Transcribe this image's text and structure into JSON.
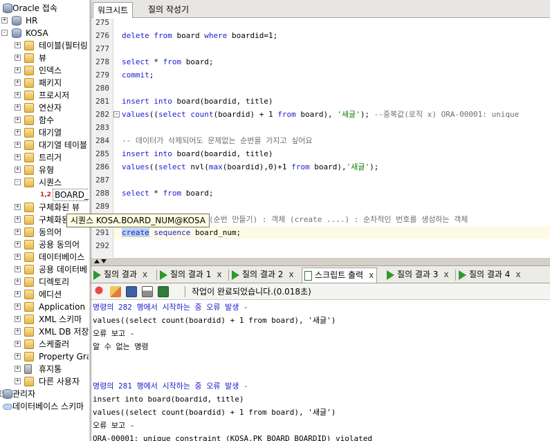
{
  "tree": {
    "items": [
      {
        "label": "Oracle 접속",
        "icon": "database-icon",
        "level": 0,
        "expander": ""
      },
      {
        "label": "HR",
        "icon": "connection-icon",
        "level": 1,
        "expander": "+"
      },
      {
        "label": "KOSA",
        "icon": "connection-icon",
        "level": 1,
        "expander": "-"
      },
      {
        "label": "테이블(필터링)",
        "icon": "table-folder-icon",
        "level": 2,
        "expander": "+"
      },
      {
        "label": "뷰",
        "icon": "view-folder-icon",
        "level": 2,
        "expander": "+"
      },
      {
        "label": "인덱스",
        "icon": "index-folder-icon",
        "level": 2,
        "expander": "+"
      },
      {
        "label": "패키지",
        "icon": "package-folder-icon",
        "level": 2,
        "expander": "+"
      },
      {
        "label": "프로시저",
        "icon": "procedure-folder-icon",
        "level": 2,
        "expander": "+"
      },
      {
        "label": "연산자",
        "icon": "operator-folder-icon",
        "level": 2,
        "expander": "+"
      },
      {
        "label": "함수",
        "icon": "function-folder-icon",
        "level": 2,
        "expander": "+"
      },
      {
        "label": "대기열",
        "icon": "queue-folder-icon",
        "level": 2,
        "expander": "+"
      },
      {
        "label": "대기열 테이블",
        "icon": "queue-table-folder-icon",
        "level": 2,
        "expander": "+"
      },
      {
        "label": "트리거",
        "icon": "trigger-folder-icon",
        "level": 2,
        "expander": "+"
      },
      {
        "label": "유형",
        "icon": "type-folder-icon",
        "level": 2,
        "expander": "+"
      },
      {
        "label": "시퀀스",
        "icon": "sequence-folder-icon",
        "level": 2,
        "expander": "-"
      },
      {
        "label": "BOARD_NUM",
        "icon": "sequence-icon",
        "level": 3,
        "expander": ""
      },
      {
        "label": "구체화된 뷰",
        "icon": "materialized-view-folder-icon",
        "level": 2,
        "expander": "+"
      },
      {
        "label": "구체화된",
        "icon": "materialized-view-log-folder-icon",
        "level": 2,
        "expander": "+"
      },
      {
        "label": "동의어",
        "icon": "synonym-folder-icon",
        "level": 2,
        "expander": "+"
      },
      {
        "label": "공용 동의어",
        "icon": "public-synonym-folder-icon",
        "level": 2,
        "expander": "+"
      },
      {
        "label": "데이터베이스",
        "icon": "db-link-folder-icon",
        "level": 2,
        "expander": "+"
      },
      {
        "label": "공용 데이터베",
        "icon": "public-db-link-folder-icon",
        "level": 2,
        "expander": "+"
      },
      {
        "label": "디렉토리",
        "icon": "directory-folder-icon",
        "level": 2,
        "expander": "+"
      },
      {
        "label": "에디션",
        "icon": "edition-folder-icon",
        "level": 2,
        "expander": "+"
      },
      {
        "label": "Application E",
        "icon": "application-express-folder-icon",
        "level": 2,
        "expander": "+"
      },
      {
        "label": "XML 스키마",
        "icon": "xml-schema-folder-icon",
        "level": 2,
        "expander": "+"
      },
      {
        "label": "XML DB 저장",
        "icon": "xml-db-folder-icon",
        "level": 2,
        "expander": "+"
      },
      {
        "label": "스케줄러",
        "icon": "scheduler-folder-icon",
        "level": 2,
        "expander": "+"
      },
      {
        "label": "Property Gra",
        "icon": "property-graph-folder-icon",
        "level": 2,
        "expander": "+"
      },
      {
        "label": "휴지통",
        "icon": "recycle-bin-icon",
        "level": 2,
        "expander": "+"
      },
      {
        "label": "다른 사용자",
        "icon": "other-users-folder-icon",
        "level": 2,
        "expander": "+"
      },
      {
        "label": "관리자",
        "icon": "admin-icon",
        "level": 0,
        "expander": "+"
      },
      {
        "label": "데이터베이스 스키마",
        "icon": "cloud-icon",
        "level": 0,
        "expander": ""
      }
    ]
  },
  "tooltip": {
    "text": "시퀀스 KOSA.BOARD_NUM@KOSA"
  },
  "editor": {
    "tabs": [
      {
        "label": "워크시트",
        "active": true
      },
      {
        "label": "질의 작성기",
        "active": false
      }
    ],
    "lines": [
      {
        "num": "275",
        "html": ""
      },
      {
        "num": "276",
        "html": "<span class='kw'>delete from</span> board <span class='kw'>where</span> boardid=1;"
      },
      {
        "num": "277",
        "html": ""
      },
      {
        "num": "278",
        "html": "<span class='kw'>select</span> * <span class='kw'>from</span> board;"
      },
      {
        "num": "279",
        "html": "<span class='kw'>commit</span>;"
      },
      {
        "num": "280",
        "html": ""
      },
      {
        "num": "281",
        "html": "<span class='kw'>insert into</span> board(boardid, title)"
      },
      {
        "num": "282",
        "html": "<span class='kw'>values</span>((<span class='kw'>select count</span>(boardid) + 1 <span class='kw'>from</span> board), <span class='str'>'새글'</span>); <span class='cm'>--중복값(로직 x) ORA-00001: unique</span>"
      },
      {
        "num": "283",
        "html": ""
      },
      {
        "num": "284",
        "html": "<span class='cm'>-- 데이터가 삭제되어도 문제없는 순번을 가지고 싶어요</span>"
      },
      {
        "num": "285",
        "html": "<span class='kw'>insert into</span> board(boardid, title)"
      },
      {
        "num": "286",
        "html": "<span class='kw'>values</span>((<span class='kw'>select</span> nvl(<span class='kw'>max</span>(boardid),0)+1 <span class='kw'>from</span> board),<span class='str'>'새글'</span>);"
      },
      {
        "num": "287",
        "html": ""
      },
      {
        "num": "288",
        "html": "<span class='kw'>select</span> * <span class='kw'>from</span> board;"
      },
      {
        "num": "289",
        "html": ""
      },
      {
        "num": "290",
        "html": "<span class='cm'>                   (순번 만들기) : 객체 (create ....) : 순차적인 번호를 생성하는 객체</span>"
      },
      {
        "num": "291",
        "html": "<span class='kw sel'>create</span> <span class='kw'>sequence</span> board_num;"
      },
      {
        "num": "292",
        "html": ""
      }
    ]
  },
  "results": {
    "tabs": [
      {
        "label": "질의 결과",
        "kind": "play",
        "active": false
      },
      {
        "label": "질의 결과 1",
        "kind": "play",
        "active": false
      },
      {
        "label": "질의 결과 2",
        "kind": "play",
        "active": false
      },
      {
        "label": "스크립트 출력",
        "kind": "doc",
        "active": true
      },
      {
        "label": "질의 결과 3",
        "kind": "play",
        "active": false
      },
      {
        "label": "질의 결과 4",
        "kind": "play",
        "active": false
      }
    ],
    "close_glyph": "x",
    "status": "작업이 완료되었습니다.(0.018초)",
    "output": [
      {
        "text": "명령의 282 행에서 시작하는 중 오류 발생 -",
        "blue": true
      },
      {
        "text": "values((select count(boardid) + 1 from board), '새글')",
        "blue": false
      },
      {
        "text": "오류 보고 -",
        "blue": false
      },
      {
        "text": "알 수 없는 명령",
        "blue": false
      },
      {
        "text": "",
        "blue": false
      },
      {
        "text": "",
        "blue": false
      },
      {
        "text": "명령의 281 행에서 시작하는 중 오류 발생 -",
        "blue": true
      },
      {
        "text": "insert into board(boardid, title)",
        "blue": false
      },
      {
        "text": "values((select count(boardid) + 1 from board), '새글')",
        "blue": false
      },
      {
        "text": "오류 보고 -",
        "blue": false
      },
      {
        "text": "ORA-00001: unique constraint (KOSA.PK_BOARD_BOARDID) violated",
        "blue": false
      }
    ]
  }
}
